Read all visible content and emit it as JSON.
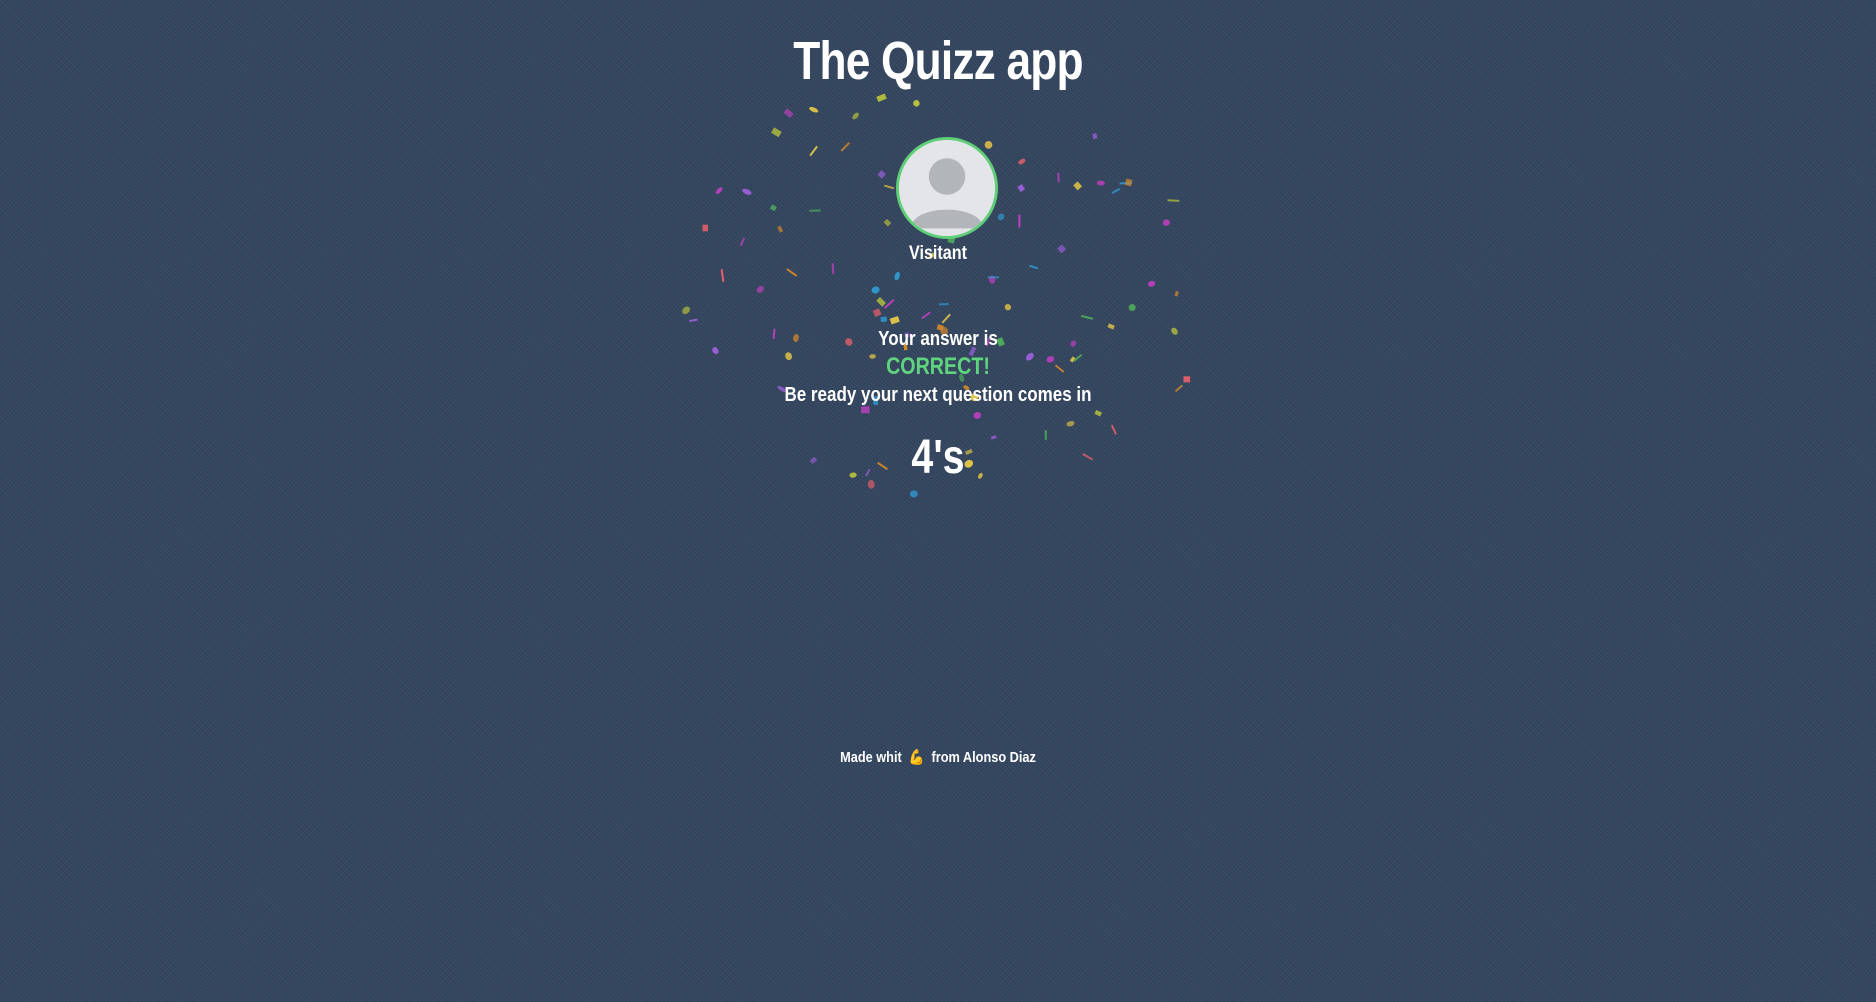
{
  "app": {
    "title": "The Quizz app"
  },
  "user": {
    "name": "Visitant",
    "avatar_icon": "user-avatar-icon"
  },
  "result": {
    "answer_label": "Your answer is",
    "status": "CORRECT!",
    "next_label": "Be ready your next question comes in",
    "countdown": "4's"
  },
  "footer": {
    "prefix": "Made whit",
    "emoji": "💪",
    "suffix": "from Alonso Diaz"
  },
  "colors": {
    "background": "#34465f",
    "accent_green": "#5fd37d",
    "text": "#ffffff"
  }
}
